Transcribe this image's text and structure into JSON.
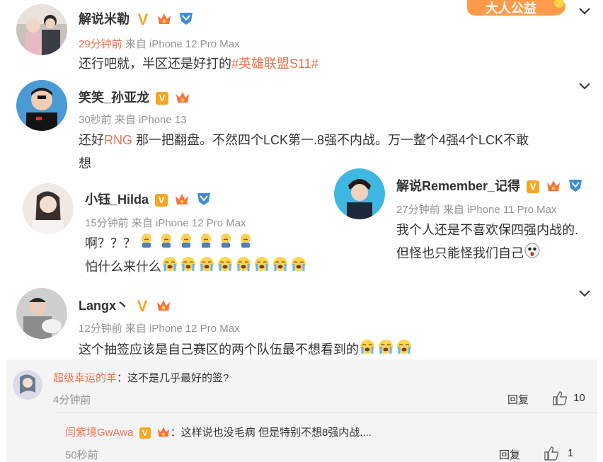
{
  "banner": {
    "label": "大人公益",
    "color": "#ff8a3c"
  },
  "colors": {
    "accent": "#eb7350",
    "meta": "#939393",
    "vbadge": "#f5a623",
    "crown": "#ff6f3c",
    "lol": "#3d8ecf"
  },
  "comments": [
    {
      "name": "解说米勒",
      "badges": [
        "v-icon",
        "crown-icon",
        "lol-icon"
      ],
      "time": "29分钟前",
      "source": "来自 iPhone 12 Pro Max",
      "text_plain": "还行吧就，半区还是好打的",
      "tag": "#英雄联盟S11#"
    },
    {
      "name": "笑笑_孙亚龙",
      "badges": [
        "v-icon",
        "crown-icon"
      ],
      "time": "30秒前",
      "source": "来自 iPhone 13",
      "line1_a": "还好",
      "line1_hl": "RNG",
      "line1_b": " 那一把翻盘。不然四个LCK第一.8强不内战。万一整个4强4个LCK不敢",
      "line2": "想"
    },
    {
      "name": "小钰_Hilda",
      "badges": [
        "v-icon",
        "crown-icon",
        "lol-icon"
      ],
      "time": "15分钟前",
      "source": "来自 iPhone 12 Pro Max",
      "line1": "啊？？？",
      "line2": "怕什么来什么"
    },
    {
      "name": "解说Remember_记得",
      "badges": [
        "v-icon",
        "crown-icon",
        "lol-icon"
      ],
      "time": "27分钟前",
      "source": "来自 iPhone 11 Pro Max",
      "line1": "我个人还是不喜欢保四强内战的.",
      "line2": "但怪也只能怪我们自己"
    },
    {
      "name": "Langx丶",
      "badges": [
        "v-icon",
        "crown-icon"
      ],
      "time": "12分钟前",
      "source": "来自 iPhone 12 Pro Max",
      "text": "这个抽签应该是自己赛区的两个队伍最不想看到的"
    }
  ],
  "replies": [
    {
      "name": "超级幸运的羊",
      "sep": "：",
      "text": "这不是几乎最好的签?",
      "time": "4分钟前",
      "reply_label": "回复",
      "likes": "10"
    },
    {
      "name": "闫紫境GwAwa",
      "sep": "：",
      "text": "这样说也没毛病 但是特别不想8强内战....",
      "time": "50秒前",
      "reply_label": "回复",
      "likes": "1"
    }
  ]
}
